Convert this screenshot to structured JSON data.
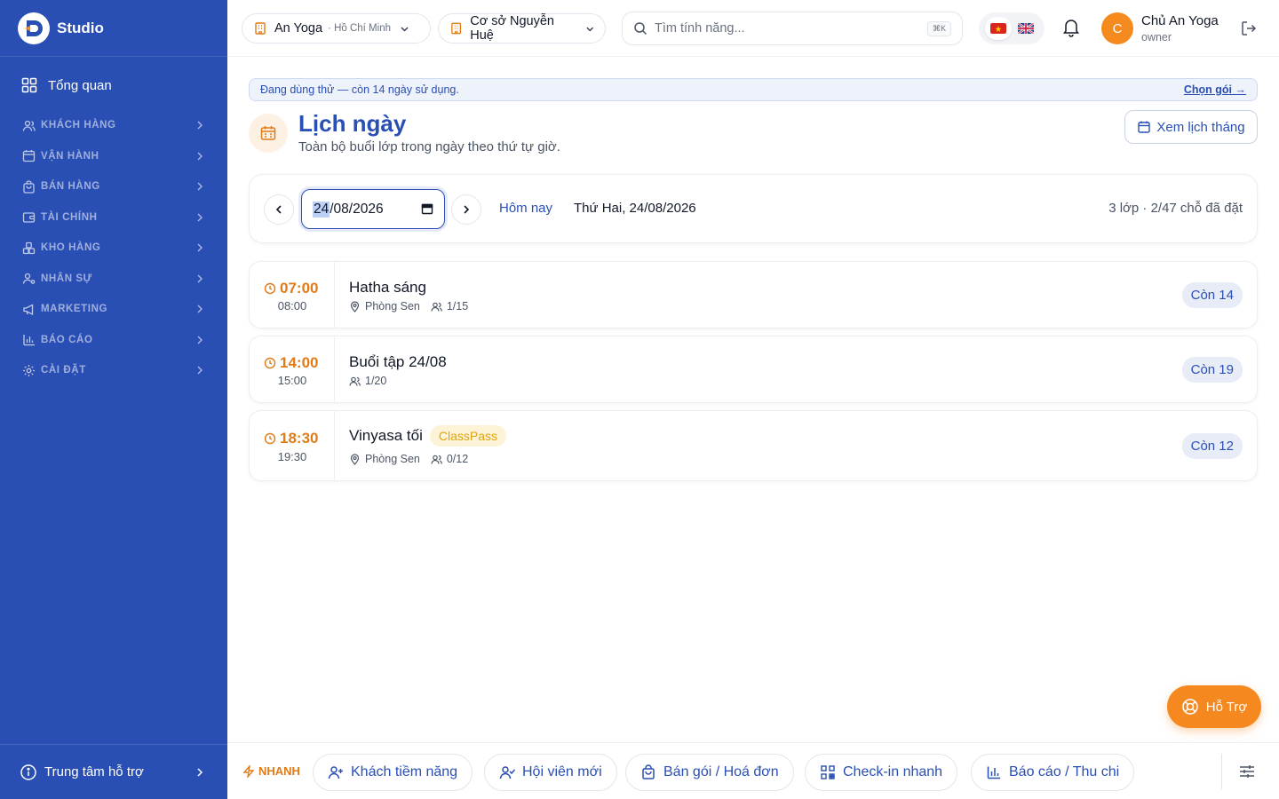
{
  "brand": {
    "name": "Studio"
  },
  "sidebar": {
    "overview": "Tổng quan",
    "groups": [
      {
        "label": "KHÁCH HÀNG",
        "icon": "users-icon"
      },
      {
        "label": "VẬN HÀNH",
        "icon": "calendar-icon"
      },
      {
        "label": "BÁN HÀNG",
        "icon": "shopping-bag-icon"
      },
      {
        "label": "TÀI CHÍNH",
        "icon": "wallet-icon"
      },
      {
        "label": "KHO HÀNG",
        "icon": "boxes-icon"
      },
      {
        "label": "NHÂN SỰ",
        "icon": "user-cog-icon"
      },
      {
        "label": "MARKETING",
        "icon": "megaphone-icon"
      },
      {
        "label": "BÁO CÁO",
        "icon": "bar-chart-icon"
      },
      {
        "label": "CÀI ĐẶT",
        "icon": "gear-icon"
      }
    ],
    "help_center": "Trung tâm hỗ trợ"
  },
  "header": {
    "org": {
      "name": "An Yoga",
      "city": "· Hồ Chí Minh"
    },
    "branch": {
      "name": "Cơ sở Nguyễn Huệ"
    },
    "search": {
      "placeholder": "Tìm tính năng...",
      "shortcut": "⌘K"
    },
    "user": {
      "initial": "C",
      "name": "Chủ An Yoga",
      "role": "owner"
    }
  },
  "trial": {
    "message": "Đang dùng thử — còn 14 ngày sử dụng.",
    "cta": "Chọn gói →"
  },
  "page": {
    "title": "Lịch ngày",
    "subtitle": "Toàn bộ buổi lớp trong ngày theo thứ tự giờ.",
    "month_button": "Xem lịch tháng"
  },
  "date_bar": {
    "date_day": "24",
    "date_rest": "/08/2026",
    "today": "Hôm nay",
    "label": "Thứ Hai, 24/08/2026",
    "summary": "3 lớp · 2/47 chỗ đã đặt"
  },
  "classes": [
    {
      "start": "07:00",
      "end": "08:00",
      "name": "Hatha sáng",
      "room": "Phòng Sen",
      "booked": "1/15",
      "remaining": "Còn 14"
    },
    {
      "start": "14:00",
      "end": "15:00",
      "name": "Buổi tập 24/08",
      "room": "",
      "booked": "1/20",
      "remaining": "Còn 19"
    },
    {
      "start": "18:30",
      "end": "19:30",
      "name": "Vinyasa tối",
      "badge": "ClassPass",
      "room": "Phòng Sen",
      "booked": "0/12",
      "remaining": "Còn 12"
    }
  ],
  "support": "Hỗ Trợ",
  "quick_bar": {
    "label": "NHANH",
    "actions": [
      {
        "label": "Khách tiềm năng",
        "icon": "user-plus-icon"
      },
      {
        "label": "Hội viên mới",
        "icon": "user-check-icon"
      },
      {
        "label": "Bán gói / Hoá đơn",
        "icon": "shopping-bag-icon"
      },
      {
        "label": "Check-in nhanh",
        "icon": "qr-code-icon"
      },
      {
        "label": "Báo cáo / Thu chi",
        "icon": "bar-chart-icon"
      }
    ]
  },
  "colors": {
    "primary": "#2a4fb4",
    "accent": "#f5891f",
    "classpass": "#e0a312"
  }
}
